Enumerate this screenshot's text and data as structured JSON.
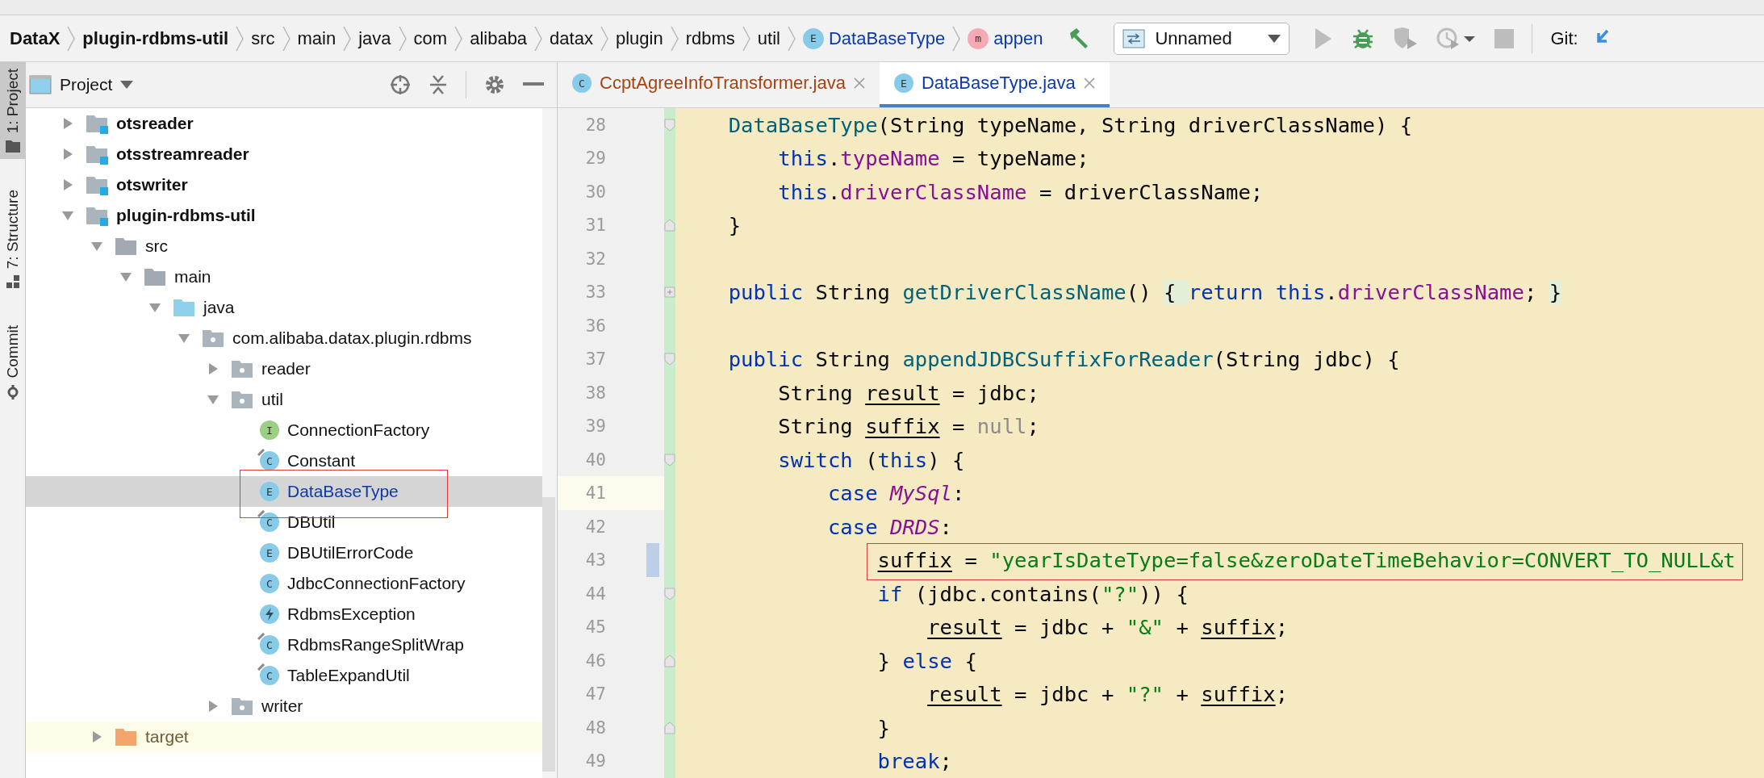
{
  "breadcrumb": [
    {
      "label": "DataX",
      "kind": "module"
    },
    {
      "label": "plugin-rdbms-util",
      "kind": "module"
    },
    {
      "label": "src",
      "kind": "dir"
    },
    {
      "label": "main",
      "kind": "dir"
    },
    {
      "label": "java",
      "kind": "dir"
    },
    {
      "label": "com",
      "kind": "dir"
    },
    {
      "label": "alibaba",
      "kind": "dir"
    },
    {
      "label": "datax",
      "kind": "dir"
    },
    {
      "label": "plugin",
      "kind": "dir"
    },
    {
      "label": "rdbms",
      "kind": "dir"
    },
    {
      "label": "util",
      "kind": "dir"
    },
    {
      "label": "DataBaseType",
      "kind": "class",
      "icon_letter": "E"
    },
    {
      "label": "appen",
      "kind": "method",
      "icon_letter": "m"
    }
  ],
  "run_config": {
    "label": "Unnamed"
  },
  "git_label": "Git:",
  "side_tabs": [
    {
      "label": "1: Project",
      "kind": "project",
      "selected": true
    },
    {
      "label": "7: Structure",
      "kind": "structure",
      "selected": false
    },
    {
      "label": "Commit",
      "kind": "commit",
      "selected": false
    }
  ],
  "project_panel": {
    "title": "Project",
    "tree": [
      {
        "label": "otsreader",
        "kind": "module",
        "expanded": false,
        "selected": false
      },
      {
        "label": "otsstreamreader",
        "kind": "module",
        "expanded": false,
        "selected": false
      },
      {
        "label": "otswriter",
        "kind": "module",
        "expanded": false,
        "selected": false
      },
      {
        "label": "plugin-rdbms-util",
        "kind": "module",
        "expanded": true,
        "selected": false,
        "children": [
          {
            "label": "src",
            "kind": "folder",
            "expanded": true,
            "selected": false,
            "children": [
              {
                "label": "main",
                "kind": "folder",
                "expanded": true,
                "selected": false,
                "children": [
                  {
                    "label": "java",
                    "kind": "source",
                    "expanded": true,
                    "selected": false,
                    "children": [
                      {
                        "label": "com.alibaba.datax.plugin.rdbms",
                        "kind": "package",
                        "expanded": true,
                        "selected": false,
                        "children": [
                          {
                            "label": "reader",
                            "kind": "package",
                            "expanded": false,
                            "selected": false
                          },
                          {
                            "label": "util",
                            "kind": "package",
                            "expanded": true,
                            "selected": false,
                            "children": [
                              {
                                "label": "ConnectionFactory",
                                "kind": "interface",
                                "icon_letter": "I",
                                "selected": false
                              },
                              {
                                "label": "Constant",
                                "kind": "class",
                                "icon_letter": "C",
                                "marked": true,
                                "selected": false
                              },
                              {
                                "label": "DataBaseType",
                                "kind": "class",
                                "icon_letter": "E",
                                "selected": true,
                                "annotated": true
                              },
                              {
                                "label": "DBUtil",
                                "kind": "class",
                                "icon_letter": "C",
                                "marked": true,
                                "selected": false
                              },
                              {
                                "label": "DBUtilErrorCode",
                                "kind": "class",
                                "icon_letter": "E",
                                "selected": false
                              },
                              {
                                "label": "JdbcConnectionFactory",
                                "kind": "class",
                                "icon_letter": "C",
                                "selected": false
                              },
                              {
                                "label": "RdbmsException",
                                "kind": "exception",
                                "selected": false
                              },
                              {
                                "label": "RdbmsRangeSplitWrap",
                                "kind": "class",
                                "icon_letter": "C",
                                "marked": true,
                                "selected": false
                              },
                              {
                                "label": "TableExpandUtil",
                                "kind": "class",
                                "icon_letter": "C",
                                "marked": true,
                                "selected": false
                              }
                            ]
                          },
                          {
                            "label": "writer",
                            "kind": "package",
                            "expanded": false,
                            "selected": false
                          }
                        ]
                      }
                    ]
                  }
                ]
              }
            ]
          },
          {
            "label": "target",
            "kind": "excluded",
            "expanded": false,
            "selected": false
          }
        ]
      }
    ]
  },
  "editor": {
    "tabs": [
      {
        "label": "CcptAgreeInfoTransformer.java",
        "icon_letter": "C",
        "color": "#a8420f",
        "selected": false
      },
      {
        "label": "DataBaseType.java",
        "icon_letter": "E",
        "color": "#0b3aa8",
        "selected": true
      }
    ],
    "lines": [
      {
        "number": "28",
        "fold_start": true,
        "tokens": [
          {
            "text": "    DataBaseType",
            "kind": "decl"
          },
          {
            "text": "(String typeName, String driverClassName) {",
            "kind": "plain"
          }
        ]
      },
      {
        "number": "29",
        "tokens": [
          {
            "text": "        this",
            "kind": "kw"
          },
          {
            "text": ".",
            "kind": "plain"
          },
          {
            "text": "typeName",
            "kind": "field"
          },
          {
            "text": " = typeName;",
            "kind": "plain"
          }
        ]
      },
      {
        "number": "30",
        "tokens": [
          {
            "text": "        this",
            "kind": "kw"
          },
          {
            "text": ".",
            "kind": "plain"
          },
          {
            "text": "driverClassName",
            "kind": "field"
          },
          {
            "text": " = driverClassName;",
            "kind": "plain"
          }
        ]
      },
      {
        "number": "31",
        "fold_end": true,
        "tokens": [
          {
            "text": "    }",
            "kind": "plain"
          }
        ]
      },
      {
        "number": "32"
      },
      {
        "number": "33",
        "folded": true,
        "tokens": [
          {
            "text": "    public",
            "kind": "kw"
          },
          {
            "text": " String ",
            "kind": "plain"
          },
          {
            "text": "getDriverClassName",
            "kind": "decl"
          },
          {
            "text": "() ",
            "kind": "plain"
          },
          {
            "text": "{ ",
            "kind": "fold"
          },
          {
            "text": "return ",
            "kind": "kw"
          },
          {
            "text": "this",
            "kind": "kw"
          },
          {
            "text": ".",
            "kind": "plain"
          },
          {
            "text": "driverClassName",
            "kind": "field"
          },
          {
            "text": ";",
            "kind": "plain"
          },
          {
            "text": " }",
            "kind": "fold"
          }
        ]
      },
      {
        "number": "36"
      },
      {
        "number": "37",
        "fold_start": true,
        "tokens": [
          {
            "text": "    public",
            "kind": "kw"
          },
          {
            "text": " String ",
            "kind": "plain"
          },
          {
            "text": "appendJDBCSuffixForReader",
            "kind": "decl"
          },
          {
            "text": "(String jdbc) {",
            "kind": "plain"
          }
        ]
      },
      {
        "number": "38",
        "tokens": [
          {
            "text": "        String ",
            "kind": "plain"
          },
          {
            "text": "result",
            "kind": "var"
          },
          {
            "text": " = jdbc;",
            "kind": "plain"
          }
        ]
      },
      {
        "number": "39",
        "tokens": [
          {
            "text": "        String ",
            "kind": "plain"
          },
          {
            "text": "suffix",
            "kind": "var"
          },
          {
            "text": " = ",
            "kind": "plain"
          },
          {
            "text": "null",
            "kind": "null"
          },
          {
            "text": ";",
            "kind": "plain"
          }
        ]
      },
      {
        "number": "40",
        "fold_start": true,
        "tokens": [
          {
            "text": "        switch",
            "kind": "kw"
          },
          {
            "text": " (",
            "kind": "plain"
          },
          {
            "text": "this",
            "kind": "kw"
          },
          {
            "text": ") {",
            "kind": "plain"
          }
        ]
      },
      {
        "number": "41",
        "current": true,
        "tokens": [
          {
            "text": "            case ",
            "kind": "kw"
          },
          {
            "text": "MySql",
            "kind": "enum"
          },
          {
            "text": ":",
            "kind": "plain"
          }
        ]
      },
      {
        "number": "42",
        "current": false,
        "tokens": [
          {
            "text": "            case ",
            "kind": "kw"
          },
          {
            "text": "DRDS",
            "kind": "enum"
          },
          {
            "text": ":",
            "kind": "plain"
          }
        ]
      },
      {
        "number": "43",
        "changed": true,
        "annotated": true,
        "tokens": [
          {
            "text": "                suffix",
            "kind": "var"
          },
          {
            "text": " = ",
            "kind": "plain"
          },
          {
            "text": "\"yearIsDateType=false&zeroDateTimeBehavior=CONVERT_TO_NULL&t",
            "kind": "string"
          }
        ]
      },
      {
        "number": "44",
        "fold_start": true,
        "tokens": [
          {
            "text": "                if",
            "kind": "kw"
          },
          {
            "text": " (jdbc.contains(",
            "kind": "plain"
          },
          {
            "text": "\"?\"",
            "kind": "string"
          },
          {
            "text": ")) {",
            "kind": "plain"
          }
        ]
      },
      {
        "number": "45",
        "tokens": [
          {
            "text": "                    result",
            "kind": "var"
          },
          {
            "text": " = jdbc + ",
            "kind": "plain"
          },
          {
            "text": "\"&\"",
            "kind": "string"
          },
          {
            "text": " + ",
            "kind": "plain"
          },
          {
            "text": "suffix",
            "kind": "var"
          },
          {
            "text": ";",
            "kind": "plain"
          }
        ]
      },
      {
        "number": "46",
        "fold_end": true,
        "tokens": [
          {
            "text": "                } ",
            "kind": "plain"
          },
          {
            "text": "else",
            "kind": "kw"
          },
          {
            "text": " {",
            "kind": "plain"
          }
        ]
      },
      {
        "number": "47",
        "tokens": [
          {
            "text": "                    result",
            "kind": "var"
          },
          {
            "text": " = jdbc + ",
            "kind": "plain"
          },
          {
            "text": "\"?\"",
            "kind": "string"
          },
          {
            "text": " + ",
            "kind": "plain"
          },
          {
            "text": "suffix",
            "kind": "var"
          },
          {
            "text": ";",
            "kind": "plain"
          }
        ]
      },
      {
        "number": "48",
        "fold_end": true,
        "tokens": [
          {
            "text": "                }",
            "kind": "plain"
          }
        ]
      },
      {
        "number": "49",
        "tokens": [
          {
            "text": "                break",
            "kind": "kw"
          },
          {
            "text": ";",
            "kind": "plain"
          }
        ]
      }
    ]
  }
}
